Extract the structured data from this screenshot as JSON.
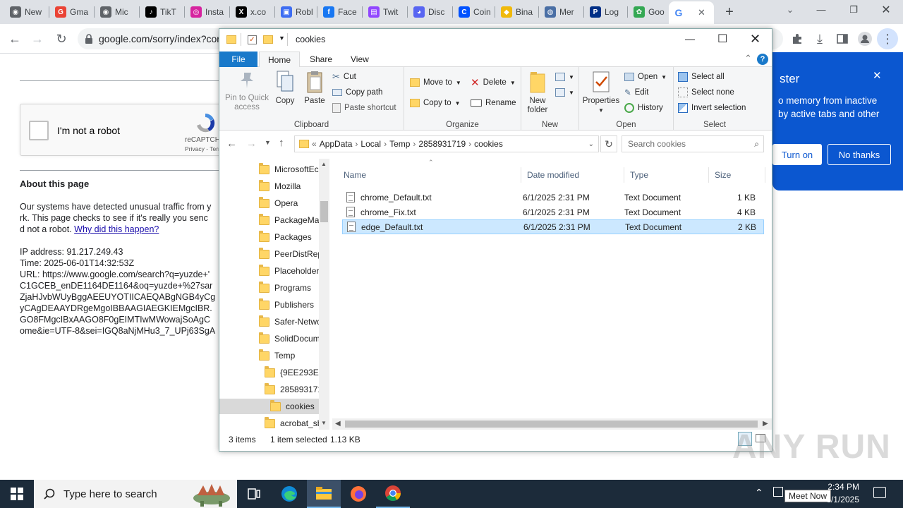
{
  "chrome": {
    "tabs": [
      {
        "label": "New",
        "color": "#5f6368",
        "glyph": "◉"
      },
      {
        "label": "Gma",
        "color": "#ea4335",
        "glyph": "G"
      },
      {
        "label": "Mic",
        "color": "#5f6368",
        "glyph": "◉"
      },
      {
        "label": "TikT",
        "color": "#000000",
        "glyph": "♪"
      },
      {
        "label": "Insta",
        "color": "#d6249f",
        "glyph": "◎"
      },
      {
        "label": "x.co",
        "color": "#000000",
        "glyph": "X"
      },
      {
        "label": "Robl",
        "color": "#3d6df2",
        "glyph": "▣"
      },
      {
        "label": "Face",
        "color": "#1877f2",
        "glyph": "f"
      },
      {
        "label": "Twit",
        "color": "#9146ff",
        "glyph": "▤"
      },
      {
        "label": "Disc",
        "color": "#5865f2",
        "glyph": "◕"
      },
      {
        "label": "Coin",
        "color": "#0052ff",
        "glyph": "C"
      },
      {
        "label": "Bina",
        "color": "#f0b90b",
        "glyph": "◆"
      },
      {
        "label": "Mer",
        "color": "#4a6fa5",
        "glyph": "◍"
      },
      {
        "label": "Log",
        "color": "#003087",
        "glyph": "P"
      },
      {
        "label": "Goo",
        "color": "#34a853",
        "glyph": "✿"
      }
    ],
    "active_tab_glyph": "G",
    "omnibox_url": "google.com/sorry/index?cor",
    "new_tab_glyph": "+",
    "tab_close_glyph": "✕",
    "window_controls": {
      "minimize": "—",
      "restore": "❐",
      "close": "✕"
    },
    "toolbar_glyphs": {
      "back": "←",
      "forward": "→",
      "reload": "↻",
      "lock": "🔒",
      "extensions": "✚",
      "download": "⤓",
      "sidepanel": "▮",
      "profile": "●",
      "menu": "⋮"
    }
  },
  "sorry_page": {
    "captcha_label": "I'm not a robot",
    "captcha_brand": "reCAPTCH",
    "captcha_links": "Privacy - Terr",
    "about_heading": "About this page",
    "para_line1": "Our systems have detected unusual traffic from y",
    "para_line2": "rk. This page checks to see if it's really you senc",
    "para_line3_pre": "d not a robot. ",
    "why_link": "Why did this happen?",
    "ip_line": "IP address: 91.217.249.43",
    "time_line": "Time: 2025-06-01T14:32:53Z",
    "url_lines": [
      "URL: https://www.google.com/search?q=yuzde+'",
      "C1GCEB_enDE1164DE1164&oq=yuzde+%27sar",
      "ZjaHJvbWUyBggAEEUYOTIICAEQABgNGB4yCg",
      "yCAgDEAAYDRgeMgoIBBAAGIAEGKIEMgcIBR.",
      "GO8FMgcIBxAAGO8F0gEIMTIwMWowajSoAgC",
      "ome&ie=UTF-8&sei=IGQ8aNjMHu3_7_UPj63SgA"
    ]
  },
  "explorer": {
    "title": "cookies",
    "title_controls": {
      "minimize": "—",
      "maximize": "☐",
      "close": "✕"
    },
    "ribbon_tabs": [
      "File",
      "Home",
      "Share",
      "View"
    ],
    "ribbon_collapse_glyph": "⌃",
    "help_glyph": "?",
    "clipboard": {
      "pin_label_1": "Pin to Quick",
      "pin_label_2": "access",
      "copy": "Copy",
      "paste": "Paste",
      "cut": "Cut",
      "copy_path": "Copy path",
      "paste_shortcut": "Paste shortcut",
      "group": "Clipboard"
    },
    "organize": {
      "move_to": "Move to",
      "copy_to": "Copy to",
      "delete": "Delete",
      "rename": "Rename",
      "group": "Organize"
    },
    "new": {
      "new_folder_1": "New",
      "new_folder_2": "folder",
      "group": "New"
    },
    "open": {
      "properties": "Properties",
      "open": "Open",
      "edit": "Edit",
      "history": "History",
      "group": "Open"
    },
    "select": {
      "select_all": "Select all",
      "select_none": "Select none",
      "invert": "Invert selection",
      "group": "Select"
    },
    "address": {
      "prefix": "«",
      "crumbs": [
        "AppData",
        "Local",
        "Temp",
        "2858931719",
        "cookies"
      ],
      "sep": "›"
    },
    "search_placeholder": "Search cookies",
    "nav_items": [
      {
        "label": "MicrosoftEc",
        "indent": 0
      },
      {
        "label": "Mozilla",
        "indent": 0
      },
      {
        "label": "Opera",
        "indent": 0
      },
      {
        "label": "PackageMa",
        "indent": 0
      },
      {
        "label": "Packages",
        "indent": 0
      },
      {
        "label": "PeerDistRep",
        "indent": 0
      },
      {
        "label": "Placeholder",
        "indent": 0
      },
      {
        "label": "Programs",
        "indent": 0
      },
      {
        "label": "Publishers",
        "indent": 0
      },
      {
        "label": "Safer-Netwo",
        "indent": 0
      },
      {
        "label": "SolidDocum",
        "indent": 0
      },
      {
        "label": "Temp",
        "indent": 0
      },
      {
        "label": "{9EE293E3-",
        "indent": 1
      },
      {
        "label": "285893171",
        "indent": 1
      },
      {
        "label": "cookies",
        "indent": 2,
        "selected": true
      },
      {
        "label": "acrobat_sb",
        "indent": 1
      }
    ],
    "columns": {
      "name": "Name",
      "date": "Date modified",
      "type": "Type",
      "size": "Size"
    },
    "files": [
      {
        "name": "chrome_Default.txt",
        "date": "6/1/2025 2:31 PM",
        "type": "Text Document",
        "size": "1 KB",
        "selected": false
      },
      {
        "name": "chrome_Fix.txt",
        "date": "6/1/2025 2:31 PM",
        "type": "Text Document",
        "size": "4 KB",
        "selected": false
      },
      {
        "name": "edge_Default.txt",
        "date": "6/1/2025 2:31 PM",
        "type": "Text Document",
        "size": "2 KB",
        "selected": true
      }
    ],
    "status": {
      "count": "3 items",
      "selected": "1 item selected",
      "size": "1.13 KB"
    }
  },
  "popup": {
    "title": "ster",
    "body_line1": "o memory from inactive",
    "body_line2": "by active tabs and other",
    "turn_on": "Turn on",
    "no_thanks": "No thanks",
    "close_glyph": "✕"
  },
  "watermark": "ANY RUN",
  "taskbar": {
    "search_placeholder": "Type here to search",
    "time": "2:34 PM",
    "date": "6/1/2025",
    "tooltip": "Meet Now"
  }
}
